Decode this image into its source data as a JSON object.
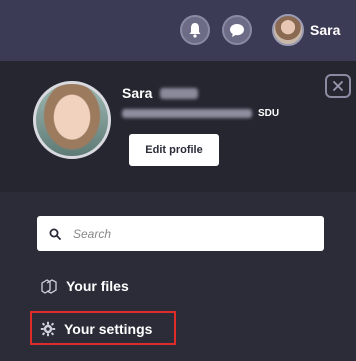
{
  "topbar": {
    "user_name": "Sara",
    "icons": {
      "notifications": "bell-icon",
      "messages": "chat-bubble-icon"
    }
  },
  "profile": {
    "name": "Sara",
    "organization": "SDU",
    "edit_label": "Edit profile",
    "close_icon": "close-icon"
  },
  "search": {
    "placeholder": "Search"
  },
  "menu": {
    "files_label": "Your files",
    "settings_label": "Your settings"
  },
  "colors": {
    "topbar": "#3b3b55",
    "panel": "#262631",
    "menu": "#2c2c39",
    "highlight": "#e02b2b"
  }
}
